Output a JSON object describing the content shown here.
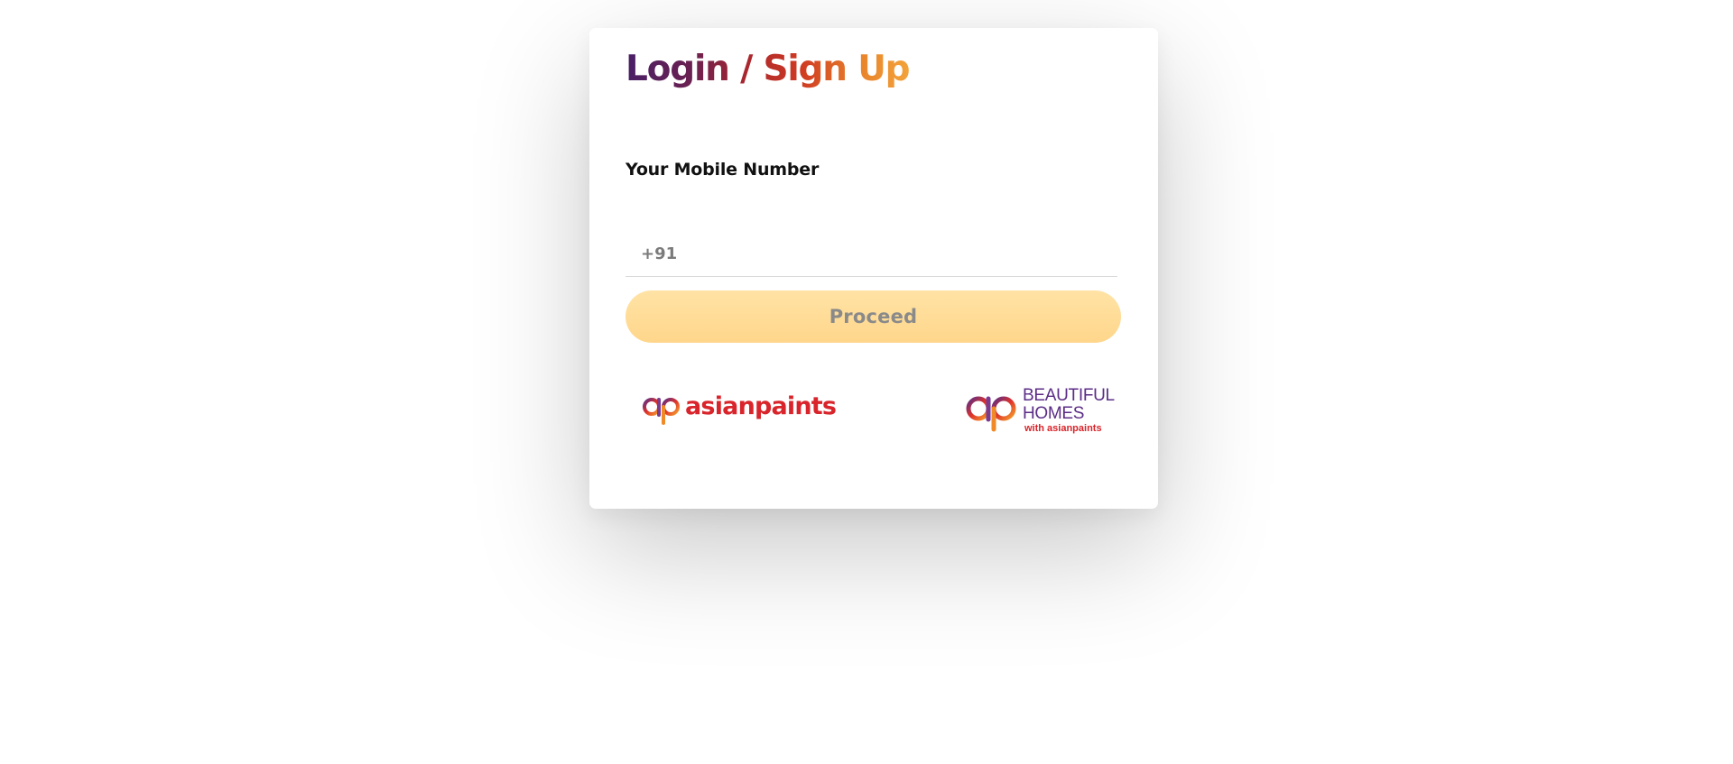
{
  "login": {
    "title": "Login / Sign Up",
    "mobile_label": "Your Mobile Number",
    "country_code": "+91",
    "mobile_value": "",
    "mobile_placeholder": "",
    "proceed_label": "Proceed"
  },
  "logos": {
    "left": {
      "wordmark": "asianpaints"
    },
    "right": {
      "line1": "BEAUTIFUL",
      "line2": "HOMES",
      "line3": "with asianpaints"
    }
  },
  "colors": {
    "title_gradient": [
      "#4a1f66",
      "#cf3a22",
      "#f2a33a"
    ],
    "button_bg": "#ffd68b",
    "brand_red": "#d8242a",
    "brand_purple": "#5b2d86"
  }
}
